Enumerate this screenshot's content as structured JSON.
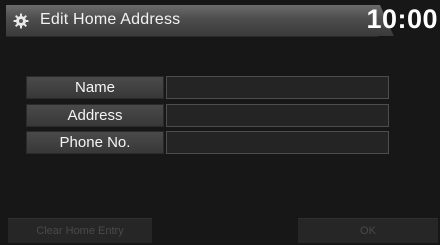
{
  "header": {
    "icon": "gear-icon",
    "title": "Edit Home Address",
    "time": "10:00"
  },
  "form": {
    "rows": [
      {
        "label": "Name",
        "value": ""
      },
      {
        "label": "Address",
        "value": ""
      },
      {
        "label": "Phone No.",
        "value": ""
      }
    ]
  },
  "footer": {
    "clear_label": "Clear Home Entry",
    "ok_label": "OK"
  },
  "colors": {
    "background": "#171717",
    "title_bar": "#4d4d4d",
    "disabled_text": "#4a4a4a"
  }
}
